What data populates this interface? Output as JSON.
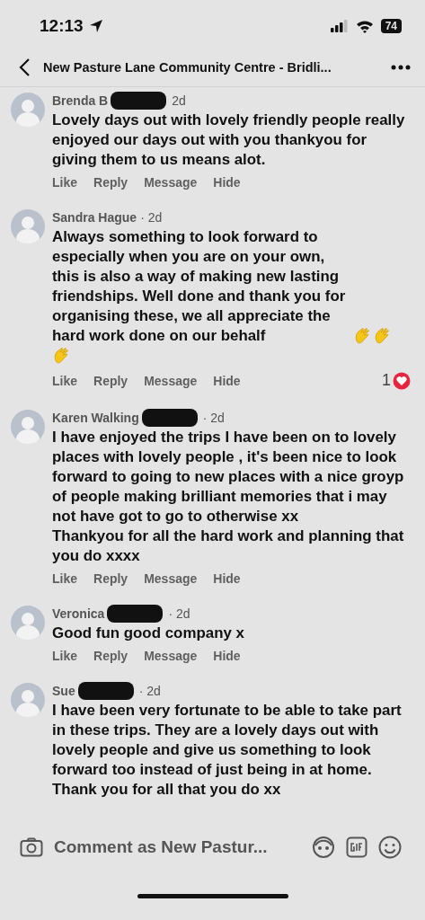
{
  "status_bar": {
    "time": "12:13",
    "battery": "74"
  },
  "header": {
    "title": "New Pasture Lane Community Centre - Bridli..."
  },
  "comments": [
    {
      "author": "Brenda B",
      "redacted": true,
      "time": "2d",
      "text": "Lovely days out with lovely friendly people really enjoyed our days out with you thankyou for giving them to us means alot.",
      "actions": [
        "Like",
        "Reply",
        "Message",
        "Hide"
      ]
    },
    {
      "author": "Sandra Hague",
      "time": "· 2d",
      "text": "Always something to look forward to especially when you are on your own, this is also a way of making new lasting friendships. Well done and thank you for organising these, we all appreciate the hard work done on our behalf",
      "emoji": [
        {
          "kind": "clap"
        },
        {
          "kind": "clap"
        },
        {
          "kind": "clap"
        }
      ],
      "actions": [
        "Like",
        "Reply",
        "Message",
        "Hide"
      ],
      "reactions": {
        "count": "1",
        "kind": "heart"
      }
    },
    {
      "author": "Karen Walking",
      "redacted": true,
      "time": "· 2d",
      "text": "I have enjoyed the trips I have been on to lovely places with lovely people , it's been nice to look forward to going to new places with a nice groyp of people making brilliant memories that i may not have got to go to otherwise xx\nThankyou for all the hard work and planning that you do xxxx",
      "actions": [
        "Like",
        "Reply",
        "Message",
        "Hide"
      ]
    },
    {
      "author": "Veronica",
      "redacted": true,
      "time": "· 2d",
      "text": "Good fun good company x",
      "actions": [
        "Like",
        "Reply",
        "Message",
        "Hide"
      ]
    },
    {
      "author": "Sue",
      "redacted": true,
      "time": "· 2d",
      "text": "I have been very fortunate to be able to take part in these trips. They are a lovely days out with lovely people and give us something to look forward too instead of just being in at home.\nThank you for all that you do xx"
    }
  ],
  "composer": {
    "placeholder": "Comment as New Pastur..."
  }
}
